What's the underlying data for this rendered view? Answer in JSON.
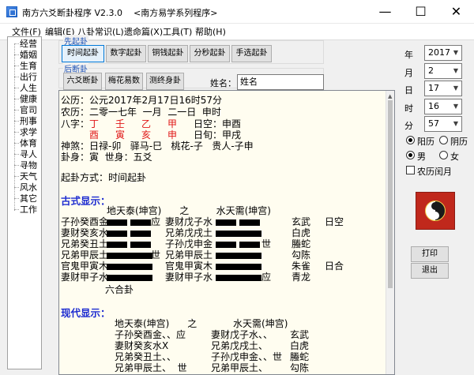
{
  "titlebar": {
    "title": "南方六爻断卦程序 V2.3.0    <南方易学系列程序>",
    "minimize": "—",
    "maximize": "☐",
    "close": "✕"
  },
  "menubar": {
    "items": [
      "文件(F)",
      "编辑(E)",
      "八卦常识(L)",
      "遗命篇(X)",
      "工具(T)",
      "帮助(H)"
    ]
  },
  "sidebar": {
    "items": [
      "经营",
      "婚姻",
      "生育",
      "出行",
      "人生",
      "健康",
      "官司",
      "刑事",
      "求学",
      "体育",
      "寻人",
      "寻物",
      "天气",
      "风水",
      "其它",
      "工作"
    ]
  },
  "first_group": {
    "label": "先起卦",
    "buttons": [
      "时间起卦",
      "数字起卦",
      "铜钱起卦",
      "分秒起卦",
      "手选起卦"
    ]
  },
  "second_group": {
    "label": "后断卦",
    "buttons": [
      "六爻断卦",
      "梅花易数",
      "测终身卦"
    ]
  },
  "name": {
    "label": "姓名：",
    "value": "姓名"
  },
  "content": {
    "lines": [
      "公历：公元2017年2月17日16时57分",
      "农历：二零一七年  一月  二一日  申时",
      "神煞：日禄-卯   驿马-巳   桃花-子   贵人-子申",
      "卦身：寅  世身：五爻",
      "起卦方式：时间起卦"
    ],
    "bazi": {
      "label": "八字：",
      "stems": [
        "丁",
        "壬",
        "乙",
        "甲"
      ],
      "branches": [
        "酉",
        "寅",
        "亥",
        "申"
      ],
      "kong1": "日空：申酉",
      "kong2": "日旬：甲戌"
    },
    "ancient": {
      "heading": "古式显示：",
      "header": "地天泰(坤宫)      之         水天需(坤宫)",
      "rows": [
        {
          "left": "子孙癸酉金",
          "right": "妻财戊子水",
          "mark": "应",
          "god": "玄武",
          "extra": "日空"
        },
        {
          "left": "妻财癸亥水",
          "right": "兄弟戊戌土",
          "mark": "",
          "god": "白虎",
          "extra": ""
        },
        {
          "left": "兄弟癸丑土",
          "right": "子孙戊申金",
          "mark": "世",
          "god": "螣蛇",
          "extra": ""
        },
        {
          "left": "兄弟甲辰土",
          "right": "兄弟甲辰土",
          "mark": "世",
          "god": "勾陈",
          "extra": ""
        },
        {
          "left": "官鬼甲寅木",
          "right": "官鬼甲寅木",
          "mark": "",
          "god": "朱雀",
          "extra": "日合"
        },
        {
          "left": "妻财甲子水",
          "right": "妻财甲子水",
          "mark": "应",
          "god": "青龙",
          "extra": ""
        }
      ],
      "footer": "六合卦"
    },
    "modern": {
      "heading": "现代显示：",
      "header": "地天泰(坤宫)      之            水天需(坤宫)",
      "rows": [
        {
          "left": "子孙癸酉金、、应",
          "right": "妻财戊子水、、",
          "god": "玄武"
        },
        {
          "left": "妻财癸亥水X",
          "right": "兄弟戊戌土、",
          "god": "白虎"
        },
        {
          "left": "兄弟癸丑土、、",
          "right": "子孙戊申金、、世",
          "god": "螣蛇"
        },
        {
          "left": "兄弟甲辰土、  世",
          "right": "兄弟甲辰土、",
          "god": "勾陈"
        }
      ]
    }
  },
  "right_panel": {
    "year_label": "年",
    "year": "2017",
    "month_label": "月",
    "month": "2",
    "day_label": "日",
    "day": "17",
    "hour_label": "时",
    "hour": "16",
    "minute_label": "分",
    "minute": "57",
    "solar": "阳历",
    "lunar": "阴历",
    "male": "男",
    "female": "女",
    "leap": "农历闰月",
    "print": "打印",
    "exit": "退出"
  },
  "colors": {
    "heading_blue": "#1c2bd0",
    "bazi_red": "#e01818",
    "content_bg": "#fffdf0",
    "taiji_red": "#c0281c"
  }
}
